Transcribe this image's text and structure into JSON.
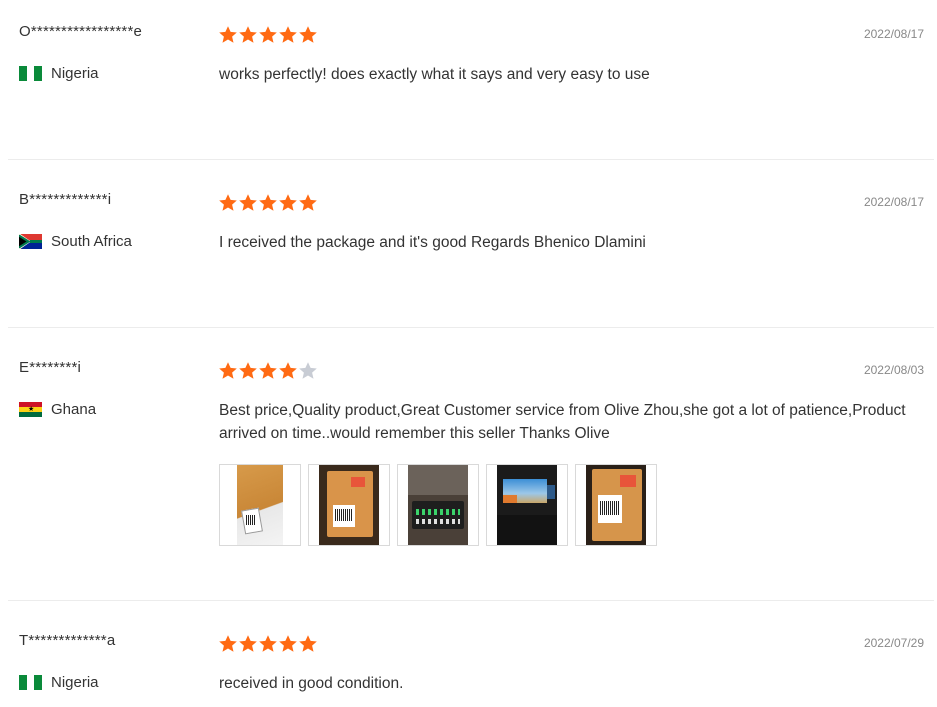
{
  "reviews": [
    {
      "name": "O*****************e",
      "country": "Nigeria",
      "flag": "nigeria-flag",
      "rating": 5,
      "date": "2022/08/17",
      "text": "works perfectly! does exactly what it says and very easy to use"
    },
    {
      "name": "B*************i",
      "country": "South Africa",
      "flag": "south-africa-flag",
      "rating": 5,
      "date": "2022/08/17",
      "text": "I received the package and it's good Regards Bhenico Dlamini"
    },
    {
      "name": "E********i",
      "country": "Ghana",
      "flag": "ghana-flag",
      "rating": 4,
      "date": "2022/08/03",
      "text": "Best price,Quality product,Great Customer service from Olive Zhou,she got a lot of patience,Product arrived on time..would remember this seller Thanks Olive",
      "photos": [
        "photo-thumbnail",
        "photo-thumbnail",
        "photo-thumbnail",
        "photo-thumbnail",
        "photo-thumbnail"
      ]
    },
    {
      "name": "T*************a",
      "country": "Nigeria",
      "flag": "nigeria-flag",
      "rating": 5,
      "date": "2022/07/29",
      "text": "received in good condition."
    }
  ],
  "colors": {
    "star_filled": "#ff6a13",
    "star_empty": "#c8ccd4",
    "divider": "#ececec"
  }
}
